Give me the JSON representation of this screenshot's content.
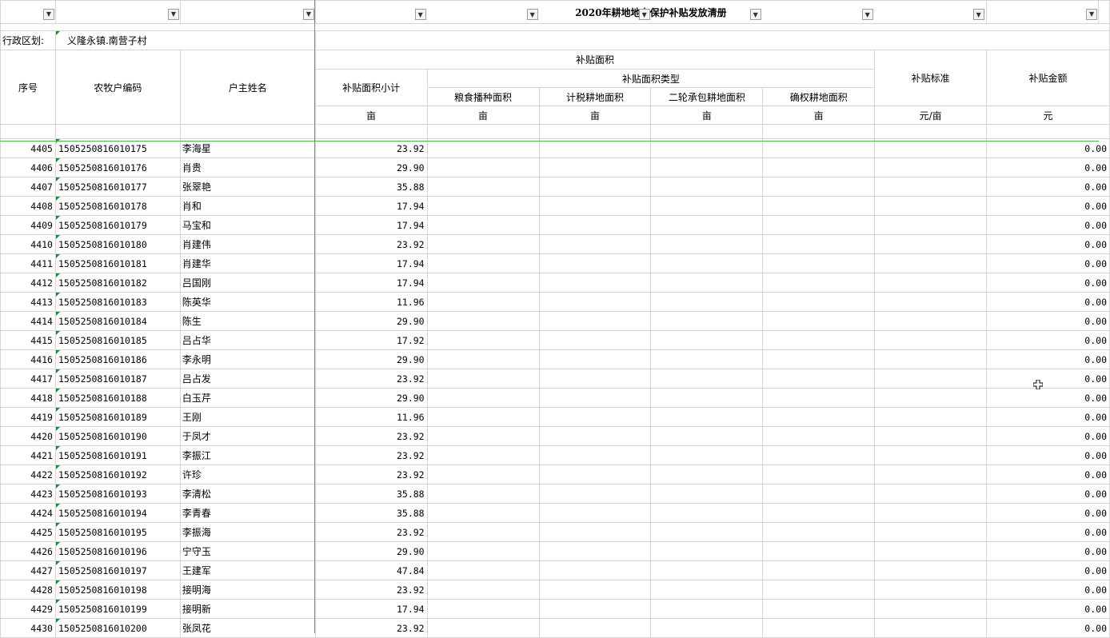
{
  "sheet": {
    "title": "2020年耕地地力保护补贴发放清册",
    "region_label": "行政区划:",
    "region_value": "义隆永镇.南营子村",
    "headers": {
      "seq": "序号",
      "code": "农牧户编码",
      "name": "户主姓名",
      "area_group": "补贴面积",
      "area_subtotal": "补贴面积小计",
      "area_type": "补贴面积类型",
      "grain": "粮食播种面积",
      "taxed": "计税耕地面积",
      "second_contract": "二轮承包耕地面积",
      "confirmed": "确权耕地面积",
      "standard": "补贴标准",
      "amount": "补贴金额"
    },
    "units": {
      "area_subtotal": "亩",
      "grain": "亩",
      "taxed": "亩",
      "second_contract": "亩",
      "confirmed": "亩",
      "standard": "元/亩",
      "amount": "元"
    },
    "rows": [
      {
        "seq": "4405",
        "code": "1505250816010175",
        "name": "李海星",
        "area": "23.92",
        "amount": "0.00"
      },
      {
        "seq": "4406",
        "code": "1505250816010176",
        "name": "肖贵",
        "area": "29.90",
        "amount": "0.00"
      },
      {
        "seq": "4407",
        "code": "1505250816010177",
        "name": "张翠艳",
        "area": "35.88",
        "amount": "0.00"
      },
      {
        "seq": "4408",
        "code": "1505250816010178",
        "name": "肖和",
        "area": "17.94",
        "amount": "0.00"
      },
      {
        "seq": "4409",
        "code": "1505250816010179",
        "name": "马宝和",
        "area": "17.94",
        "amount": "0.00"
      },
      {
        "seq": "4410",
        "code": "1505250816010180",
        "name": "肖建伟",
        "area": "23.92",
        "amount": "0.00"
      },
      {
        "seq": "4411",
        "code": "1505250816010181",
        "name": "肖建华",
        "area": "17.94",
        "amount": "0.00"
      },
      {
        "seq": "4412",
        "code": "1505250816010182",
        "name": "吕国刚",
        "area": "17.94",
        "amount": "0.00"
      },
      {
        "seq": "4413",
        "code": "1505250816010183",
        "name": "陈英华",
        "area": "11.96",
        "amount": "0.00"
      },
      {
        "seq": "4414",
        "code": "1505250816010184",
        "name": "陈生",
        "area": "29.90",
        "amount": "0.00"
      },
      {
        "seq": "4415",
        "code": "1505250816010185",
        "name": "吕占华",
        "area": "17.92",
        "amount": "0.00"
      },
      {
        "seq": "4416",
        "code": "1505250816010186",
        "name": "李永明",
        "area": "29.90",
        "amount": "0.00"
      },
      {
        "seq": "4417",
        "code": "1505250816010187",
        "name": "吕占发",
        "area": "23.92",
        "amount": "0.00"
      },
      {
        "seq": "4418",
        "code": "1505250816010188",
        "name": "白玉芹",
        "area": "29.90",
        "amount": "0.00"
      },
      {
        "seq": "4419",
        "code": "1505250816010189",
        "name": "王刚",
        "area": "11.96",
        "amount": "0.00"
      },
      {
        "seq": "4420",
        "code": "1505250816010190",
        "name": "于凤才",
        "area": "23.92",
        "amount": "0.00"
      },
      {
        "seq": "4421",
        "code": "1505250816010191",
        "name": "李振江",
        "area": "23.92",
        "amount": "0.00"
      },
      {
        "seq": "4422",
        "code": "1505250816010192",
        "name": "许珍",
        "area": "23.92",
        "amount": "0.00"
      },
      {
        "seq": "4423",
        "code": "1505250816010193",
        "name": "李清松",
        "area": "35.88",
        "amount": "0.00"
      },
      {
        "seq": "4424",
        "code": "1505250816010194",
        "name": "李青春",
        "area": "35.88",
        "amount": "0.00"
      },
      {
        "seq": "4425",
        "code": "1505250816010195",
        "name": "李振海",
        "area": "23.92",
        "amount": "0.00"
      },
      {
        "seq": "4426",
        "code": "1505250816010196",
        "name": "宁守玉",
        "area": "29.90",
        "amount": "0.00"
      },
      {
        "seq": "4427",
        "code": "1505250816010197",
        "name": "王建军",
        "area": "47.84",
        "amount": "0.00"
      },
      {
        "seq": "4428",
        "code": "1505250816010198",
        "name": "接明海",
        "area": "23.92",
        "amount": "0.00"
      },
      {
        "seq": "4429",
        "code": "1505250816010199",
        "name": "接明新",
        "area": "17.94",
        "amount": "0.00"
      },
      {
        "seq": "4430",
        "code": "1505250816010200",
        "name": "张凤花",
        "area": "23.92",
        "amount": "0.00"
      }
    ],
    "icons": {
      "filter": "filter-dropdown-icon",
      "cursor": "cell-cursor-icon"
    },
    "colors": {
      "grid": "#d4d4d4",
      "header_border": "#000000",
      "selection_green": "#1d8a2a"
    }
  }
}
